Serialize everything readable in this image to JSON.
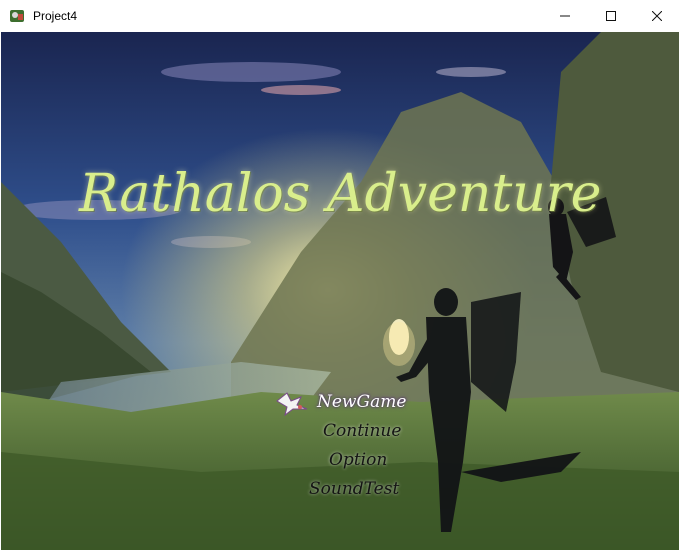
{
  "window": {
    "title": "Project4",
    "controls": [
      "minimize",
      "maximize",
      "close"
    ]
  },
  "game": {
    "title": "Rathalos Adventure"
  },
  "menu": {
    "items": [
      {
        "label": "NewGame",
        "selected": true
      },
      {
        "label": "Continue",
        "selected": false
      },
      {
        "label": "Option",
        "selected": false
      },
      {
        "label": "SoundTest",
        "selected": false
      }
    ],
    "cursor_icon": "winged-dragon-cursor-icon"
  },
  "colors": {
    "title_text": "#d9ee8c",
    "menu_selected": "#ffffff",
    "menu_normal": "#141414",
    "sky_top": "#1b2a55"
  }
}
